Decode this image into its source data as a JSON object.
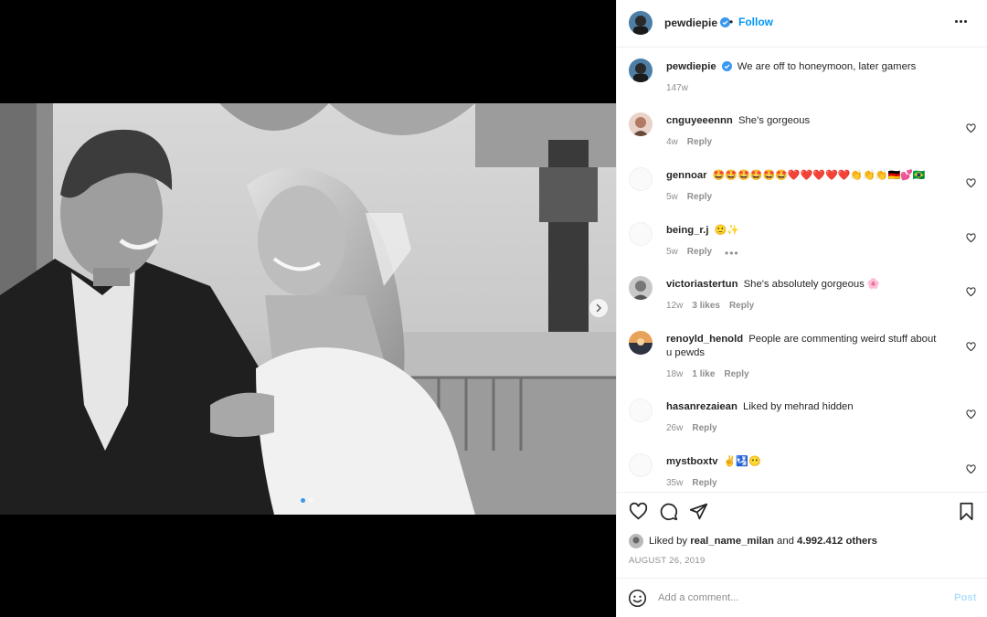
{
  "post": {
    "username": "pewdiepie",
    "separator": "•",
    "follow_label": "Follow",
    "caption": "We are off to honeymoon, later gamers",
    "caption_time": "147w"
  },
  "comments": [
    {
      "username": "cnguyeeennn",
      "text": "She's gorgeous",
      "time": "4w",
      "likes": "",
      "reply": "Reply"
    },
    {
      "username": "gennoar",
      "text": "🤩🤩🤩🤩🤩🤩❤️❤️❤️❤️❤️👏👏👏🇩🇪💕🇧🇷",
      "time": "5w",
      "likes": "",
      "reply": "Reply"
    },
    {
      "username": "being_r.j",
      "text": "🙂✨",
      "time": "5w",
      "likes": "",
      "reply": "Reply",
      "more": "•••"
    },
    {
      "username": "victoriastertun",
      "text": "She's absolutely gorgeous 🌸",
      "time": "12w",
      "likes": "3 likes",
      "reply": "Reply"
    },
    {
      "username": "renoyld_henold",
      "text": "People are commenting weird stuff about u pewds",
      "time": "18w",
      "likes": "1 like",
      "reply": "Reply"
    },
    {
      "username": "hasanrezaiean",
      "text": "Liked by mehrad hidden",
      "time": "26w",
      "likes": "",
      "reply": "Reply"
    },
    {
      "username": "mystboxtv",
      "text": "✌️🛂😶",
      "time": "35w",
      "likes": "",
      "reply": "Reply"
    }
  ],
  "likes": {
    "prefix": "Liked by",
    "user": "real_name_milan",
    "conj": "and",
    "others": "4.992.412 others"
  },
  "date": "AUGUST 26, 2019",
  "composer": {
    "placeholder": "Add a comment...",
    "post_label": "Post"
  },
  "icons": {
    "like": "heart-icon",
    "comment": "comment-icon",
    "share": "send-icon",
    "save": "bookmark-icon",
    "emoji": "smiley-icon",
    "verified": "verified-badge-icon"
  },
  "colors": {
    "accent": "#0095f6",
    "verified": "#3897f0",
    "muted": "#8e8e8e",
    "post_disabled": "#b2dffc"
  },
  "carousel": {
    "slide": 1,
    "total": 2
  }
}
